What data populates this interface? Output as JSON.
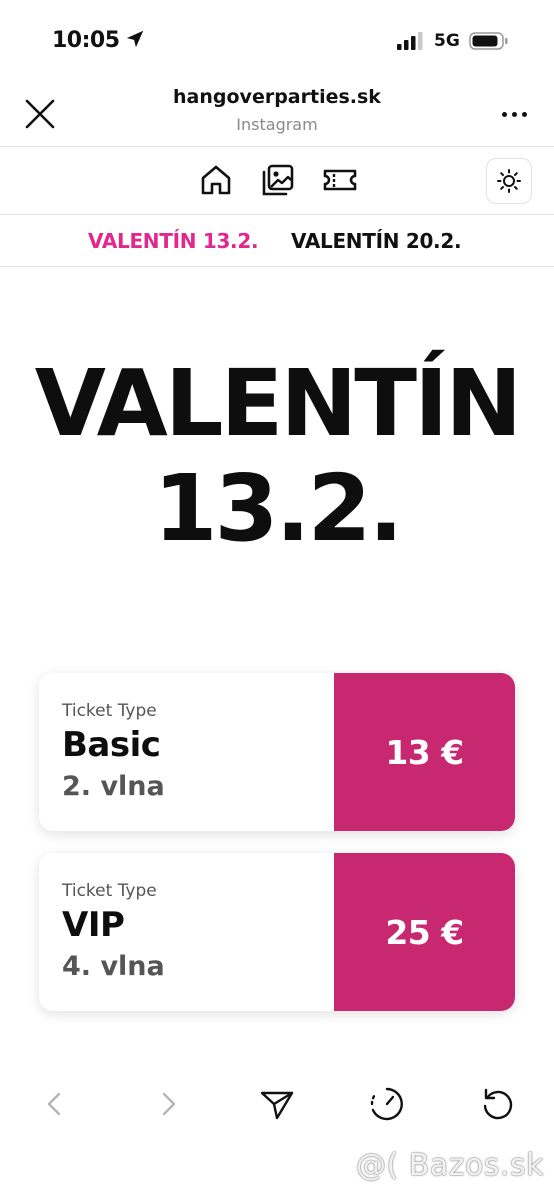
{
  "status_bar": {
    "time": "10:05",
    "network": "5G",
    "icons": [
      "location-arrow-icon",
      "signal-icon",
      "battery-icon"
    ]
  },
  "header": {
    "title": "hangoverparties.sk",
    "subtitle": "Instagram",
    "icons": [
      "close-icon",
      "more-icon"
    ]
  },
  "nav": {
    "icons": [
      "home-icon",
      "gallery-icon",
      "ticket-icon",
      "theme-icon"
    ]
  },
  "tabs": [
    {
      "label": "VALENTÍN 13.2.",
      "active": true
    },
    {
      "label": "VALENTÍN 20.2.",
      "active": false
    }
  ],
  "hero": {
    "line1": "VALENTÍN",
    "line2": "13.2."
  },
  "tickets": [
    {
      "type_label": "Ticket Type",
      "name": "Basic",
      "wave": "2. vlna",
      "price": "13 €"
    },
    {
      "type_label": "Ticket Type",
      "name": "VIP",
      "wave": "4. vlna",
      "price": "25 €"
    }
  ],
  "bottom_toolbar": {
    "icons": [
      "back-icon",
      "forward-icon",
      "share-icon",
      "speed-icon",
      "reload-icon"
    ]
  },
  "watermark": "@( Bazos.sk",
  "colors": {
    "accent": "#e0288f",
    "price_bg": "#c8286f",
    "text": "#0e0e0e"
  }
}
